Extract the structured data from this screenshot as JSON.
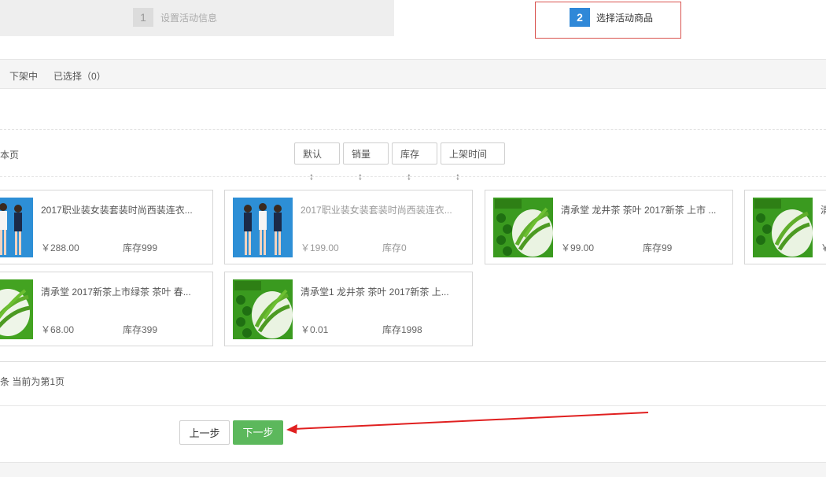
{
  "steps": [
    {
      "number": "1",
      "label": "设置活动信息"
    },
    {
      "number": "2",
      "label": "选择活动商品"
    }
  ],
  "tabs": {
    "off_shelf": "下架中",
    "selected": "已选择（0）"
  },
  "page_size_label": "本页",
  "sort_buttons": [
    {
      "label": "默认",
      "icon": "sort-icon"
    },
    {
      "label": "销量",
      "icon": "sort-icon"
    },
    {
      "label": "库存",
      "icon": "sort-icon"
    },
    {
      "label": "上架时间",
      "icon": "sort-icon"
    }
  ],
  "products": [
    {
      "title": "2017职业装女装套装时尚西装连衣...",
      "price": "￥288.00",
      "stock": "库存999",
      "dim": false,
      "thumb": "fashion"
    },
    {
      "title": "2017职业装女装套装时尚西装连衣...",
      "price": "￥199.00",
      "stock": "库存0",
      "dim": true,
      "thumb": "fashion"
    },
    {
      "title": "清承堂 龙井茶 茶叶 2017新茶 上市 ...",
      "price": "￥99.00",
      "stock": "库存99",
      "dim": false,
      "thumb": "tea-text"
    },
    {
      "title": "清",
      "price": "￥",
      "stock": "",
      "dim": false,
      "thumb": "tea-text"
    },
    {
      "title": "清承堂 2017新茶上市绿茶 茶叶 春...",
      "price": "￥68.00",
      "stock": "库存399",
      "dim": false,
      "thumb": "tea"
    },
    {
      "title": "清承堂1 龙井茶 茶叶 2017新茶 上...",
      "price": "￥0.01",
      "stock": "库存1998",
      "dim": false,
      "thumb": "tea-text"
    }
  ],
  "total_label": "条 当前为第1页",
  "buttons": {
    "prev": "上一步",
    "next": "下一步"
  },
  "colors": {
    "accent_blue": "#2f88d8",
    "next_green": "#5cb85c",
    "highlight_red": "#d9534f"
  }
}
